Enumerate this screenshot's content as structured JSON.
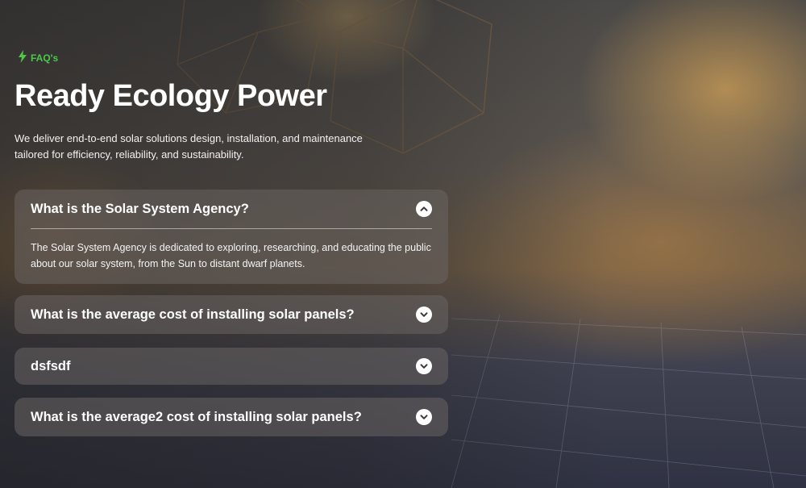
{
  "section": {
    "eyebrow": "FAQ's",
    "title": "Ready Ecology Power",
    "subtitle": "We deliver end-to-end solar solutions design, installation, and maintenance tailored for efficiency, reliability, and sustainability."
  },
  "faq": [
    {
      "question": "What is the Solar System Agency?",
      "answer": "The Solar System Agency is dedicated to exploring, researching, and educating the public about our solar system, from the Sun to distant dwarf planets.",
      "expanded": true,
      "icon": "chevron-up-icon"
    },
    {
      "question": "What is the average cost of installing solar panels?",
      "expanded": false,
      "icon": "chevron-down-icon"
    },
    {
      "question": "dsfsdf",
      "expanded": false,
      "icon": "chevron-down-icon"
    },
    {
      "question": "What is the average2 cost of installing solar panels?",
      "expanded": false,
      "icon": "chevron-down-icon"
    }
  ],
  "colors": {
    "accent": "#4cc94a",
    "text": "#ffffff",
    "card_bg": "rgba(105,100,98,0.55)"
  },
  "icons": {
    "eyebrow": "lightning-bolt-icon"
  }
}
